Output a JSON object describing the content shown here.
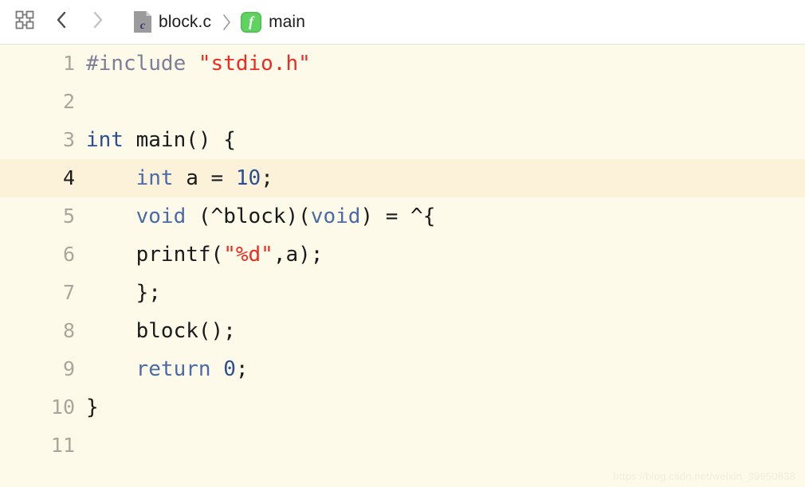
{
  "toolbar": {
    "modules_icon": "blocks-grid-icon",
    "back_icon": "chevron-left-icon",
    "forward_icon": "chevron-right-icon",
    "breadcrumb": {
      "separator": "›",
      "items": [
        {
          "label": "block.c",
          "icon": "c-file-icon",
          "icon_letter": "c"
        },
        {
          "label": "main",
          "icon": "function-icon",
          "icon_letter": "f"
        }
      ]
    }
  },
  "editor": {
    "active_line": 4,
    "colors": {
      "background": "#fdfaea",
      "active_line_background": "#fbf2d9",
      "line_number": "#a9a79c",
      "active_line_number": "#1a1a1a",
      "plain": "#1a1a1a",
      "preprocessor": "#7e7e98",
      "string": "#ec2b21",
      "keyword": "#2b4f95",
      "keyword_soft": "#4a6aa8",
      "number": "#2b4f95"
    },
    "lines": [
      {
        "n": "1",
        "tokens": [
          {
            "t": "#include ",
            "c": "t-pre"
          },
          {
            "t": "\"stdio.h\"",
            "c": "t-str"
          }
        ]
      },
      {
        "n": "2",
        "tokens": []
      },
      {
        "n": "3",
        "tokens": [
          {
            "t": "int",
            "c": "t-kw"
          },
          {
            "t": " main() {",
            "c": "t-pln"
          }
        ]
      },
      {
        "n": "4",
        "tokens": [
          {
            "t": "    ",
            "c": "t-pln"
          },
          {
            "t": "int",
            "c": "t-kw2"
          },
          {
            "t": " a = ",
            "c": "t-pln"
          },
          {
            "t": "10",
            "c": "t-num"
          },
          {
            "t": ";",
            "c": "t-pln"
          }
        ]
      },
      {
        "n": "5",
        "tokens": [
          {
            "t": "    ",
            "c": "t-pln"
          },
          {
            "t": "void",
            "c": "t-kw2"
          },
          {
            "t": " (^block)(",
            "c": "t-pln"
          },
          {
            "t": "void",
            "c": "t-kw2"
          },
          {
            "t": ") = ^{",
            "c": "t-pln"
          }
        ]
      },
      {
        "n": "6",
        "tokens": [
          {
            "t": "    printf(",
            "c": "t-pln"
          },
          {
            "t": "\"%d\"",
            "c": "t-str"
          },
          {
            "t": ",a);",
            "c": "t-pln"
          }
        ]
      },
      {
        "n": "7",
        "tokens": [
          {
            "t": "    };",
            "c": "t-pln"
          }
        ]
      },
      {
        "n": "8",
        "tokens": [
          {
            "t": "    block();",
            "c": "t-pln"
          }
        ]
      },
      {
        "n": "9",
        "tokens": [
          {
            "t": "    ",
            "c": "t-pln"
          },
          {
            "t": "return",
            "c": "t-kw2"
          },
          {
            "t": " ",
            "c": "t-pln"
          },
          {
            "t": "0",
            "c": "t-num"
          },
          {
            "t": ";",
            "c": "t-pln"
          }
        ]
      },
      {
        "n": "10",
        "tokens": [
          {
            "t": "}",
            "c": "t-pln"
          }
        ]
      },
      {
        "n": "11",
        "tokens": []
      }
    ]
  },
  "watermark": "https://blog.csdn.net/weixin_39950838"
}
